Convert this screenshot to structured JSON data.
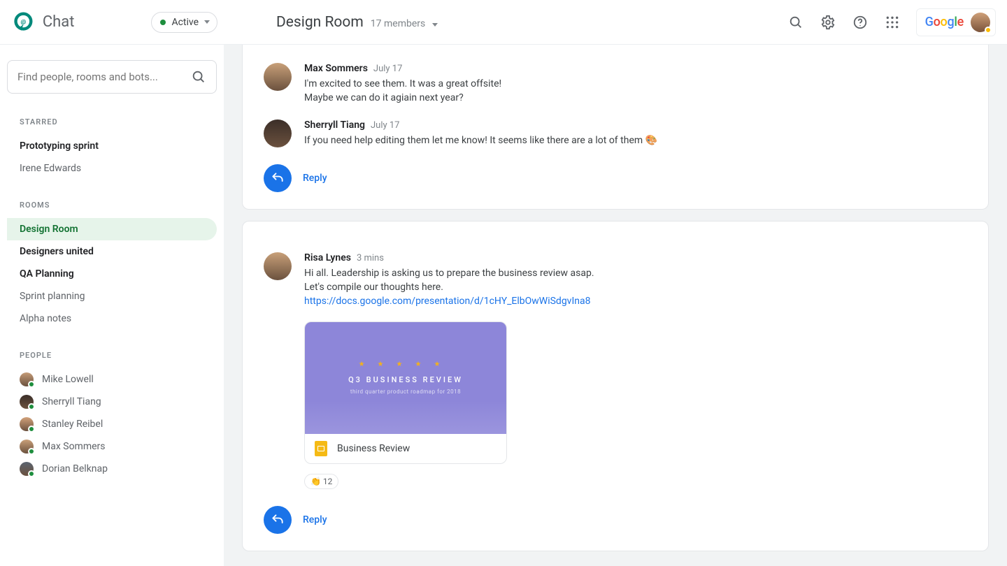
{
  "brand": {
    "product": "Chat"
  },
  "status": {
    "label": "Active"
  },
  "room": {
    "title": "Design Room",
    "subtitle": "17 members"
  },
  "search": {
    "placeholder": "Find people, rooms and bots..."
  },
  "sections": {
    "starred": {
      "label": "STARRED",
      "items": [
        {
          "label": "Prototyping sprint",
          "bold": true
        },
        {
          "label": "Irene Edwards",
          "bold": false
        }
      ]
    },
    "rooms": {
      "label": "ROOMS",
      "items": [
        {
          "label": "Design Room",
          "bold": true,
          "active": true
        },
        {
          "label": "Designers united",
          "bold": true
        },
        {
          "label": "QA Planning",
          "bold": true
        },
        {
          "label": "Sprint planning",
          "bold": false
        },
        {
          "label": "Alpha notes",
          "bold": false
        }
      ]
    },
    "people": {
      "label": "PEOPLE",
      "items": [
        {
          "label": "Mike Lowell",
          "presence": "#1e8e3e",
          "tint": "#c59b77"
        },
        {
          "label": "Sherryll Tiang",
          "presence": "#1e8e3e",
          "tint": "#3b2e28"
        },
        {
          "label": "Stanley Reibel",
          "presence": "#1e8e3e",
          "tint": "#d3a27a"
        },
        {
          "label": "Max Sommers",
          "presence": "#1e8e3e",
          "tint": "#caa079"
        },
        {
          "label": "Dorian Belknap",
          "presence": "#1e8e3e",
          "tint": "#5a6470"
        }
      ]
    }
  },
  "threads": [
    {
      "messages": [
        {
          "author": "Max Sommers",
          "time": "July 17",
          "tint": "#c8a079",
          "lines": [
            "I'm excited to see them. It was a great offsite!",
            "Maybe we can do it agiain next year?"
          ]
        },
        {
          "author": "Sherryll Tiang",
          "time": "July 17",
          "tint": "#3b2e28",
          "lines": [
            "If you need help editing them let me know! It seems like there are a lot of them 🎨"
          ]
        }
      ],
      "reply": "Reply"
    },
    {
      "messages": [
        {
          "author": "Risa Lynes",
          "time": "3 mins",
          "tint": "#c8a079",
          "lines": [
            "Hi all. Leadership is asking us to prepare the business review asap.",
            "Let's compile our thoughts here."
          ],
          "link": "https://docs.google.com/presentation/d/1cHY_ElbOwWiSdgvIna8",
          "attachment": {
            "hero_title": "Q3 BUSINESS REVIEW",
            "hero_sub": "third quarter product roadmap for 2018",
            "footer_title": "Business Review"
          },
          "reaction": {
            "emoji": "👏",
            "count": "12"
          }
        }
      ],
      "reply": "Reply"
    }
  ]
}
